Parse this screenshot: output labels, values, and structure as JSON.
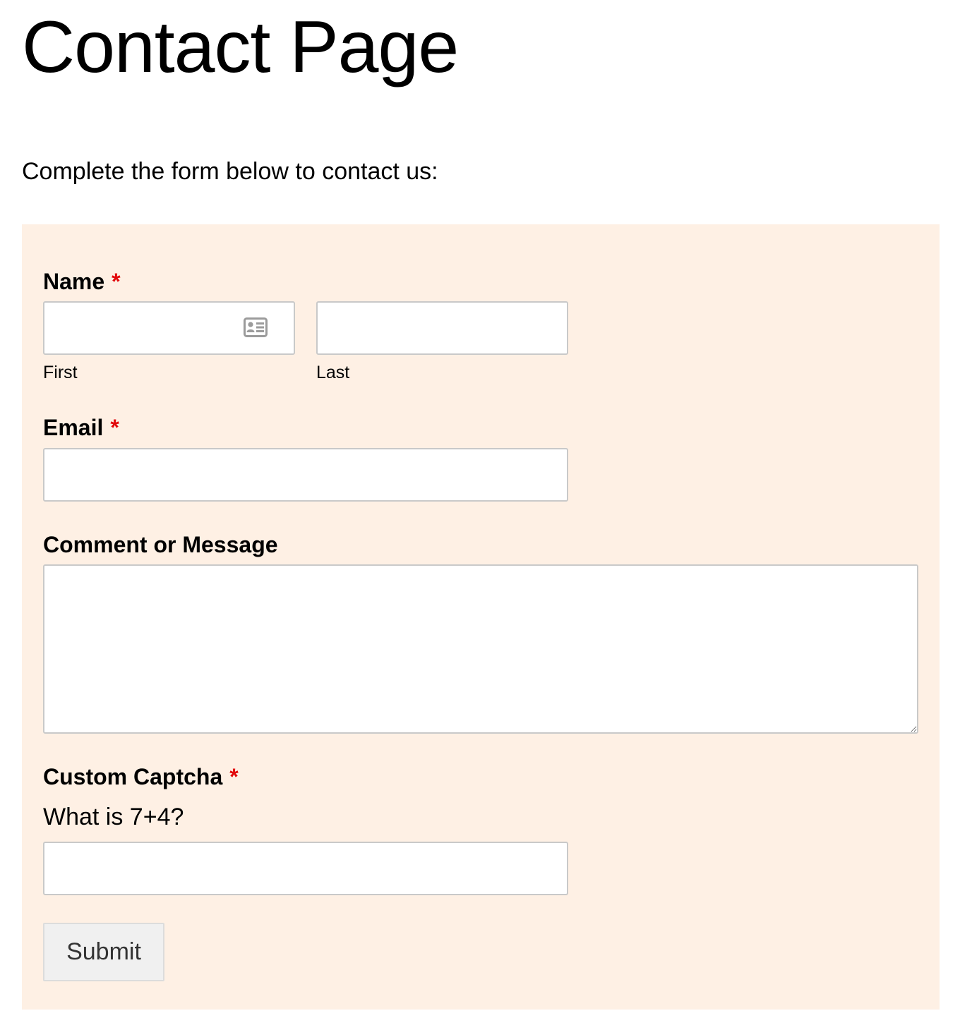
{
  "page": {
    "title": "Contact Page",
    "intro": "Complete the form below to contact us:"
  },
  "form": {
    "background_color": "#fef0e4",
    "required_marker": "*",
    "required_color": "#e2080b",
    "name": {
      "label": "Name",
      "required": true,
      "first": {
        "sublabel": "First",
        "value": "",
        "icon": "contact-card-icon"
      },
      "last": {
        "sublabel": "Last",
        "value": ""
      }
    },
    "email": {
      "label": "Email",
      "required": true,
      "value": ""
    },
    "message": {
      "label": "Comment or Message",
      "required": false,
      "value": ""
    },
    "captcha": {
      "label": "Custom Captcha",
      "required": true,
      "question": "What is 7+4?",
      "value": ""
    },
    "submit_label": "Submit"
  }
}
